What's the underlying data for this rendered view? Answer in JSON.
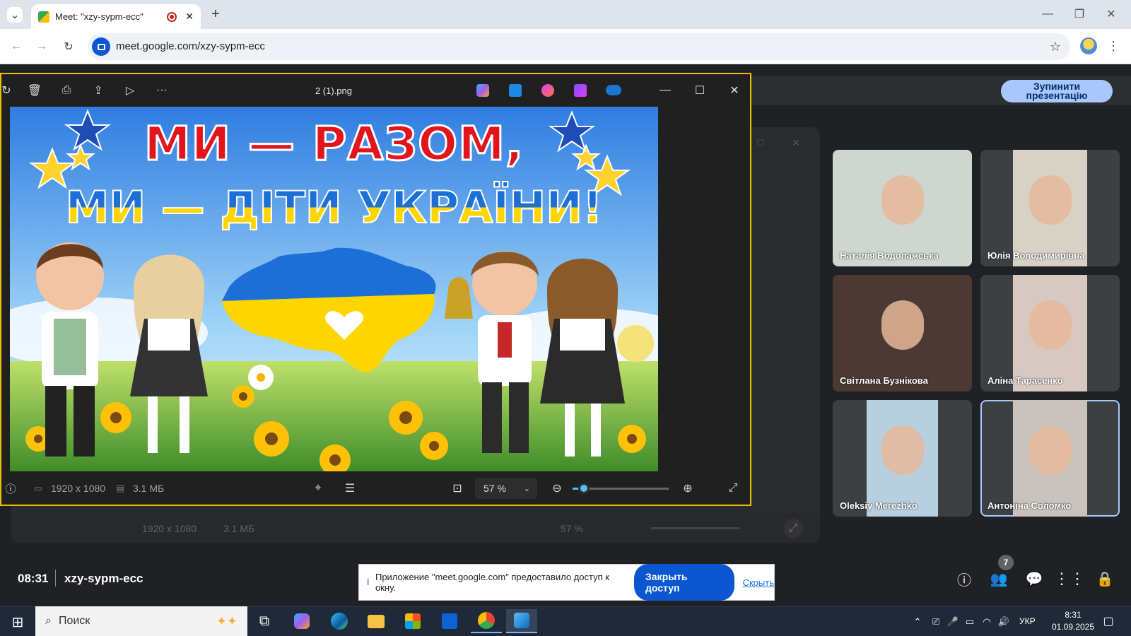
{
  "browser": {
    "tab_title": "Meet: \"xzy-sypm-ecc\"",
    "url": "meet.google.com/xzy-sypm-ecc"
  },
  "meet": {
    "stop_presenting": "Зупинити презентацію",
    "time": "08:31",
    "meeting_code": "xzy-sypm-ecc",
    "people_count": "7",
    "participants": [
      {
        "name": "Наталія Водолажська",
        "bg": "#cfd6d0"
      },
      {
        "name": "Юлія Володимирівна",
        "bg": "#d8d2c6"
      },
      {
        "name": "Світлана Бузнікова",
        "bg": "#4b3a33"
      },
      {
        "name": "Аліна Тарасенко",
        "bg": "#d7c8c2"
      },
      {
        "name": "Oleksiy Merezhko",
        "bg": "#b8cfe0"
      },
      {
        "name": "Антоніна Соломко",
        "bg": "#c9c3bd"
      }
    ]
  },
  "viewer": {
    "filename": "2 (1).png",
    "resolution": "1920 x 1080",
    "filesize": "3.1 МБ",
    "zoom": "57 %",
    "zoom_level": 0.12
  },
  "ghost_bar": {
    "resolution": "1920 x 1080",
    "filesize": "3.1 МБ",
    "zoom": "57 %"
  },
  "poster": {
    "line1": "МИ — РАЗОМ,",
    "line2": "МИ — ДІТИ УКРАЇНИ!"
  },
  "notice": {
    "text": "Приложение \"meet.google.com\" предоставило доступ к окну.",
    "stop_button": "Закрыть доступ",
    "hide_link": "Скрыть"
  },
  "taskbar": {
    "search_placeholder": "Поиск",
    "lang": "УКР",
    "clock_time": "8:31",
    "clock_date": "01.09.2025"
  },
  "colors": {
    "accent": "#0b57d0",
    "viewer_border": "#e8c200",
    "stop_btn": "#a8c7fa"
  }
}
